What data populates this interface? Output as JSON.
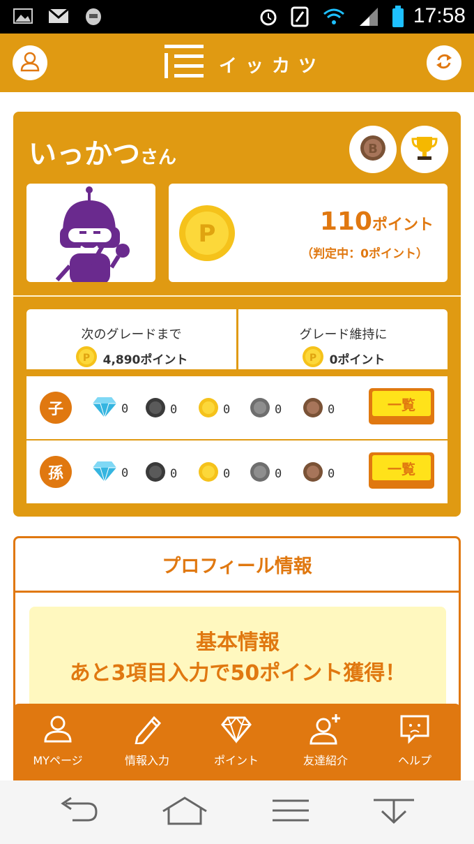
{
  "status_bar": {
    "time": "17:58",
    "icons": [
      "image-icon",
      "gmail-icon",
      "helmet-icon",
      "alarm-icon",
      "nfc-icon",
      "wifi-icon",
      "signal-icon",
      "battery-icon"
    ]
  },
  "app_bar": {
    "brand": "イッカツ",
    "left_icon": "profile-icon",
    "right_icon": "refresh-icon"
  },
  "user": {
    "name": "いっかつ",
    "suffix": "さん",
    "badges": [
      "bronze-medal-icon",
      "trophy-icon"
    ]
  },
  "points": {
    "value": "110",
    "unit": "ポイント",
    "pending": "（判定中：0ポイント）"
  },
  "grade": {
    "next_label": "次のグレードまで",
    "next_value": "4,890ポイント",
    "keep_label": "グレード維持に",
    "keep_value": "0ポイント"
  },
  "referral_rows": [
    {
      "label": "子",
      "counts": [
        "0",
        "0",
        "0",
        "0",
        "0"
      ],
      "button": "一覧"
    },
    {
      "label": "孫",
      "counts": [
        "0",
        "0",
        "0",
        "0",
        "0"
      ],
      "button": "一覧"
    }
  ],
  "medal_types": [
    "diamond",
    "black",
    "gold",
    "silver",
    "bronze"
  ],
  "profile": {
    "header": "プロフィール情報",
    "basic_title": "基本情報",
    "basic_text": "あと3項目入力で50ポイント獲得！"
  },
  "tabs": [
    {
      "label": "MYページ",
      "icon": "person-icon"
    },
    {
      "label": "情報入力",
      "icon": "pencil-icon"
    },
    {
      "label": "ポイント",
      "icon": "diamond-icon"
    },
    {
      "label": "友達紹介",
      "icon": "add-friend-icon"
    },
    {
      "label": "ヘルプ",
      "icon": "help-chat-icon"
    }
  ],
  "nav": [
    "back-icon",
    "home-icon",
    "menu-icon",
    "download-icon"
  ],
  "colors": {
    "primary": "#e09a12",
    "accent": "#e07810",
    "button_yellow": "#ffe21a",
    "basic_bg": "#fff8bf"
  }
}
